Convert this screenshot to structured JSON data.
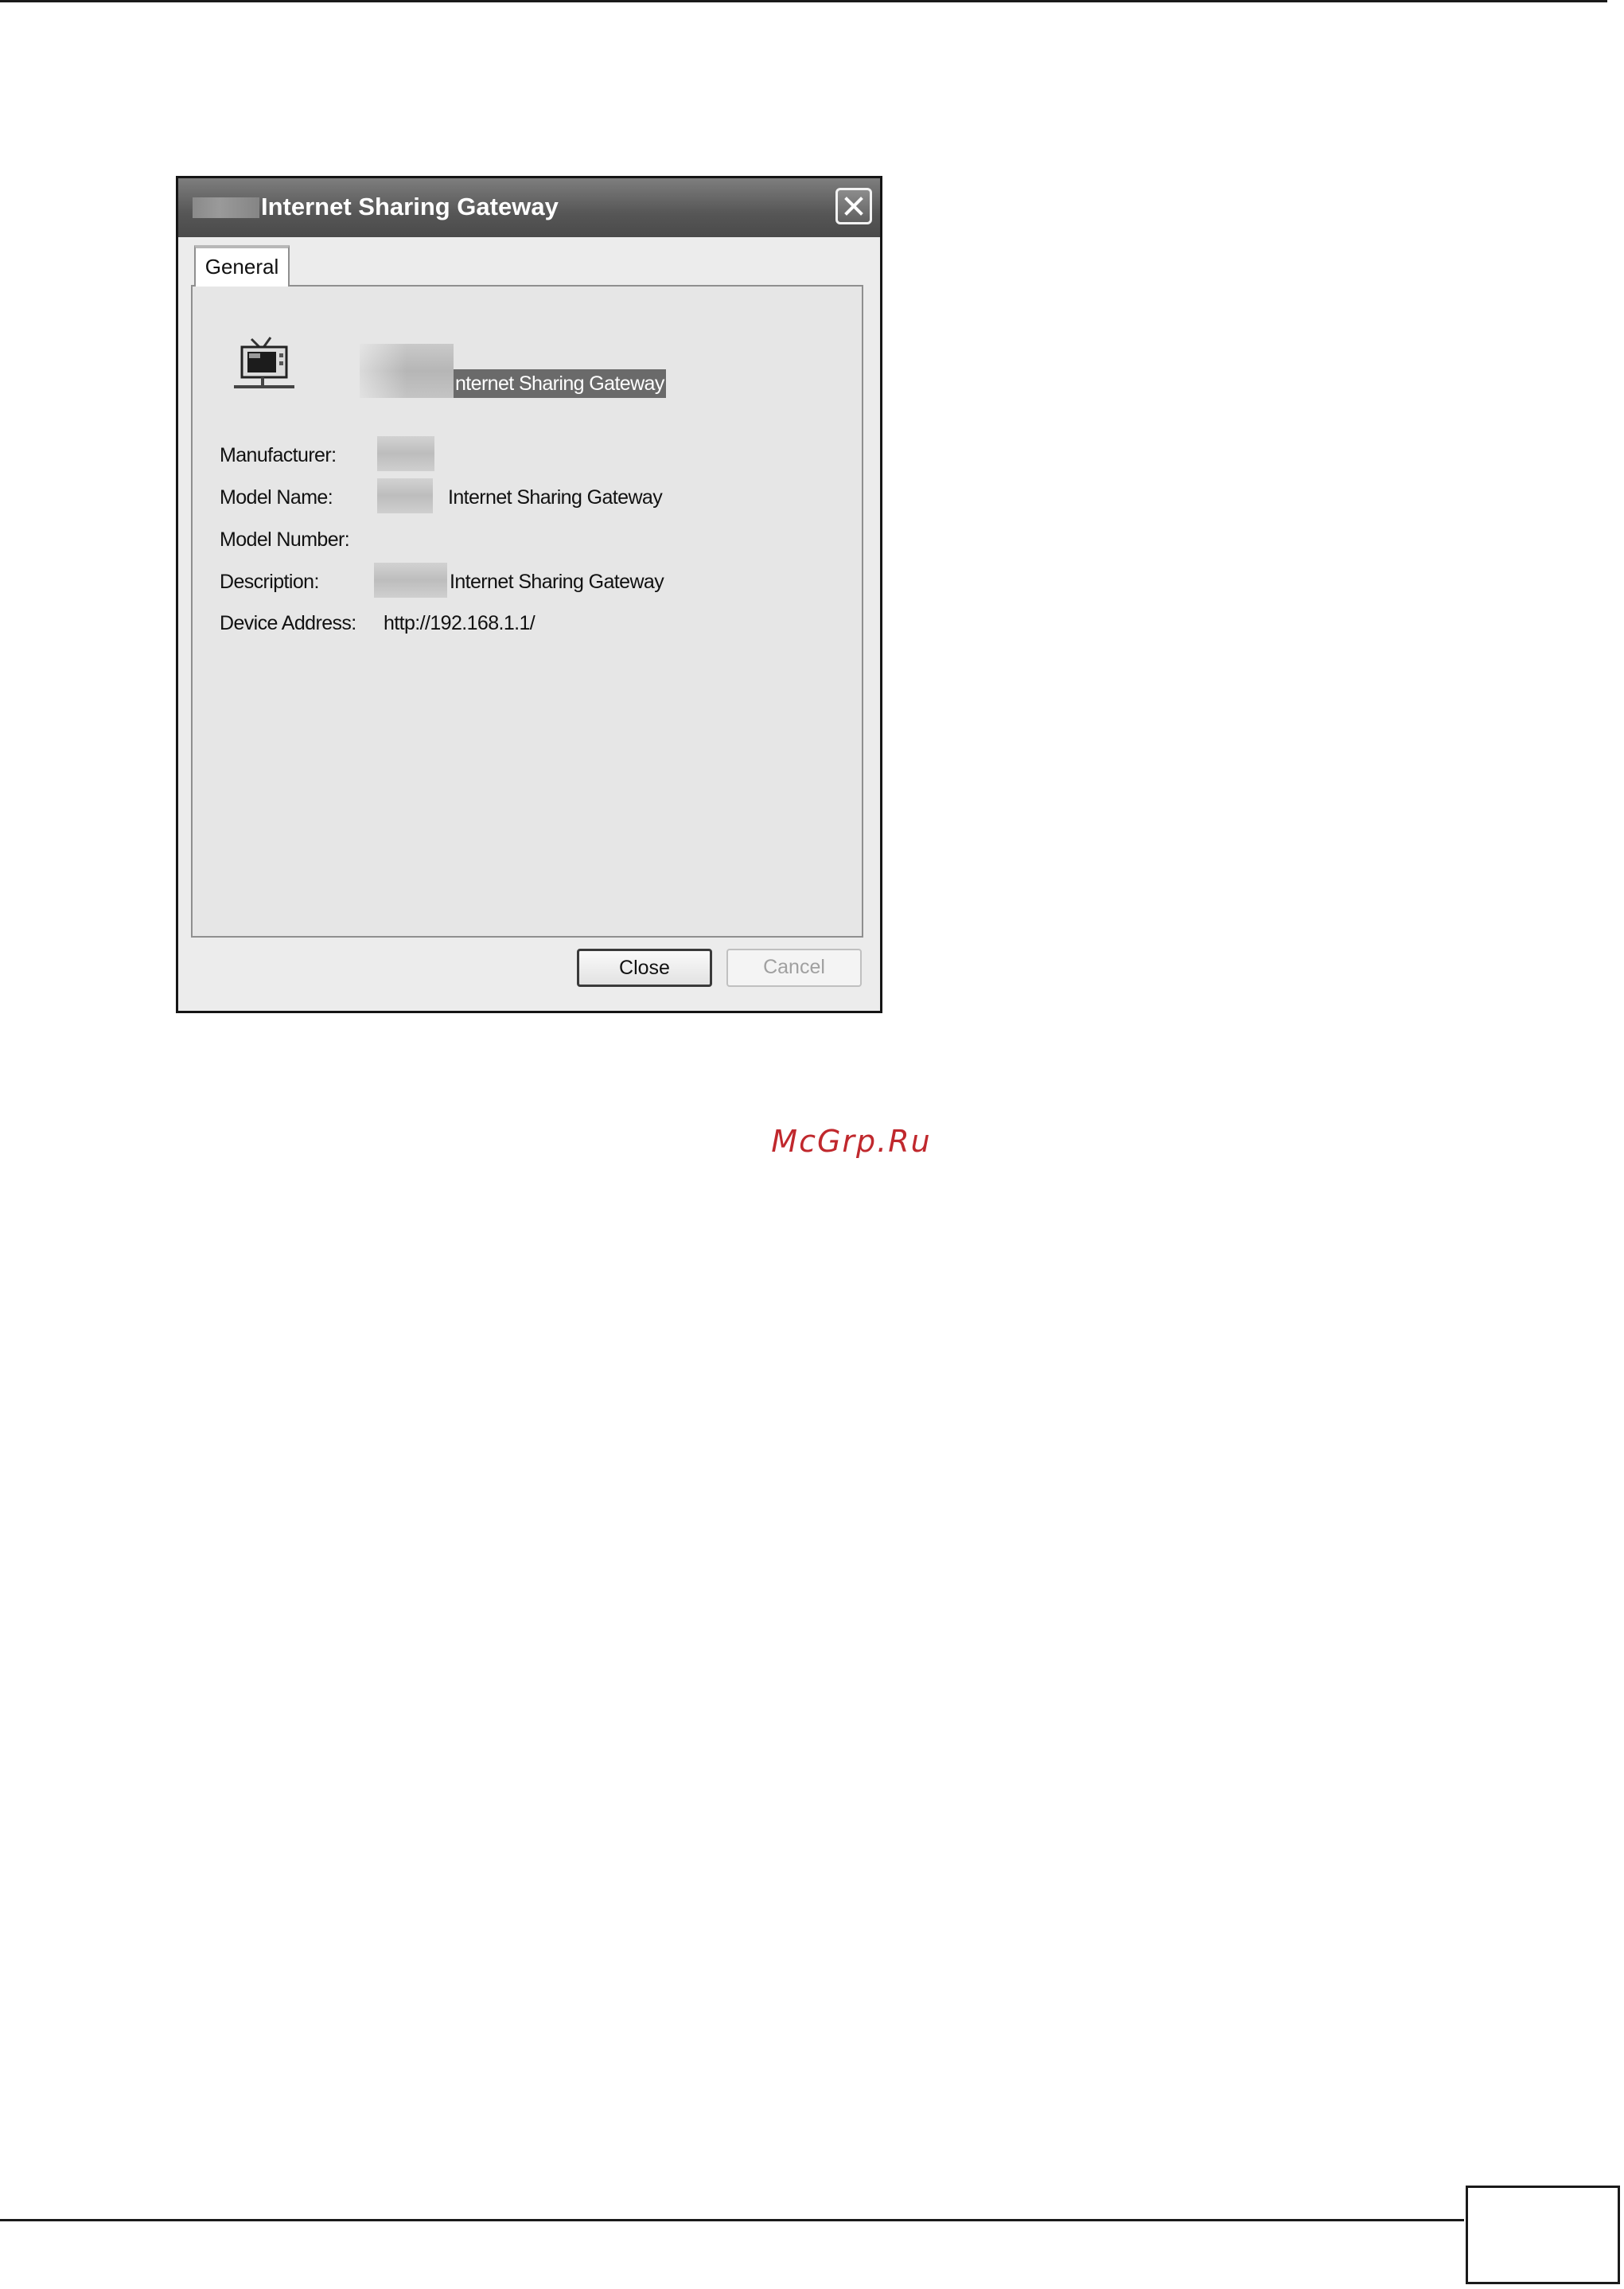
{
  "dialog": {
    "title": "Internet Sharing Gateway",
    "tab_general": "General",
    "device_name_visible": "nternet Sharing Gateway",
    "fields": [
      {
        "label": "Manufacturer:",
        "value": ""
      },
      {
        "label": "Model Name:",
        "value": "Internet Sharing Gateway"
      },
      {
        "label": "Model Number:",
        "value": ""
      },
      {
        "label": "Description:",
        "value": "Internet Sharing Gateway"
      },
      {
        "label": "Device Address:",
        "value": "http://192.168.1.1/"
      }
    ],
    "buttons": {
      "close": "Close",
      "cancel": "Cancel"
    }
  },
  "watermark": "McGrp.Ru",
  "icons": [
    "close-icon",
    "network-device-icon"
  ],
  "colors": {
    "watermark": "#c0282d",
    "titlebar": "#565656",
    "selection": "#6a6a6a"
  }
}
